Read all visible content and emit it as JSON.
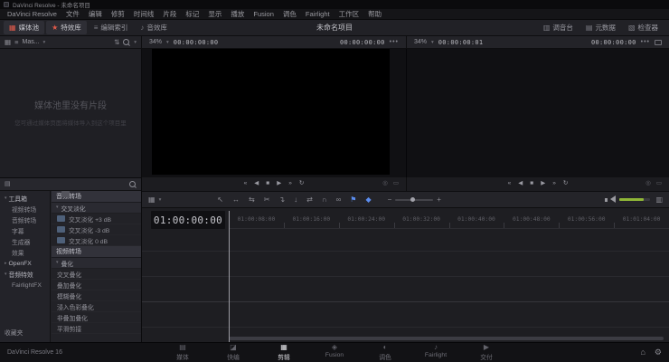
{
  "window": {
    "titlebar": "DaVinci Resolve - 未命名项目",
    "project_title": "未命名项目",
    "version_label": "DaVinci Resolve 16"
  },
  "colors": {
    "accent": "#e05a4a",
    "marker_blue": "#5b8def",
    "audio_level_green": "#8fb637"
  },
  "menubar": {
    "items": [
      "DaVinci Resolve",
      "文件",
      "编辑",
      "修剪",
      "时间线",
      "片段",
      "标记",
      "显示",
      "播放",
      "Fusion",
      "调色",
      "Fairlight",
      "工作区",
      "帮助"
    ]
  },
  "panel_toolbar": {
    "left": [
      {
        "name": "media-pool",
        "icon": "media-pool-icon",
        "glyph": "▦",
        "label": "媒体池",
        "active": true
      },
      {
        "name": "effects-library",
        "icon": "effects-library-icon",
        "glyph": "★",
        "label": "特效库",
        "active": true
      },
      {
        "name": "edit-index",
        "icon": "edit-index-icon",
        "glyph": "≡",
        "label": "编辑索引",
        "active": false
      },
      {
        "name": "sound-library",
        "icon": "sound-library-icon",
        "glyph": "♪",
        "label": "音效库",
        "active": false
      }
    ],
    "right": [
      {
        "name": "mixer",
        "icon": "mixer-icon",
        "glyph": "▥",
        "label": "调音台",
        "active": false
      },
      {
        "name": "metadata",
        "icon": "metadata-icon",
        "glyph": "▤",
        "label": "元数据",
        "active": false
      },
      {
        "name": "inspector",
        "icon": "inspector-icon",
        "glyph": "▧",
        "label": "检查器",
        "active": false
      }
    ]
  },
  "media_pool": {
    "bin_label": "Mas...",
    "empty_title": "媒体池里没有片段",
    "empty_subtitle": "您可通过媒体页面将媒体导入到这个项目里"
  },
  "effects_panel": {
    "nav": [
      {
        "name": "toolbox",
        "label": "工具箱",
        "level": 0,
        "header": true,
        "expandable": true,
        "expanded": true
      },
      {
        "name": "video-transitions",
        "label": "视频转场",
        "level": 1
      },
      {
        "name": "audio-transitions",
        "label": "音频转场",
        "level": 1
      },
      {
        "name": "titles",
        "label": "字幕",
        "level": 1
      },
      {
        "name": "generators",
        "label": "生成器",
        "level": 1
      },
      {
        "name": "effects",
        "label": "效果",
        "level": 1
      },
      {
        "name": "openfx",
        "label": "OpenFX",
        "level": 0,
        "header": true,
        "expandable": true,
        "expanded": false
      },
      {
        "name": "audio-fx",
        "label": "音频特效",
        "level": 0,
        "header": true,
        "expandable": true,
        "expanded": true
      },
      {
        "name": "fairlightfx",
        "label": "FairlightFX",
        "level": 1
      },
      {
        "name": "favorites",
        "label": "收藏夹",
        "level": 0,
        "bottom": true
      }
    ],
    "list": [
      {
        "type": "header",
        "label": "音频转场"
      },
      {
        "type": "group",
        "label": "交叉淡化"
      },
      {
        "type": "item",
        "label": "交叉淡化 +3 dB",
        "kind": "audio"
      },
      {
        "type": "item",
        "label": "交叉淡化 -3 dB",
        "kind": "audio"
      },
      {
        "type": "item",
        "label": "交叉淡化 0 dB",
        "kind": "audio"
      },
      {
        "type": "header",
        "label": "视频转场"
      },
      {
        "type": "group",
        "label": "叠化"
      },
      {
        "type": "item",
        "label": "交叉叠化",
        "kind": "video"
      },
      {
        "type": "item",
        "label": "叠加叠化",
        "kind": "video"
      },
      {
        "type": "item",
        "label": "模糊叠化",
        "kind": "video"
      },
      {
        "type": "item",
        "label": "浸入色彩叠化",
        "kind": "video"
      },
      {
        "type": "item",
        "label": "非叠加叠化",
        "kind": "video"
      },
      {
        "type": "item",
        "label": "平滑剪接",
        "kind": "video"
      }
    ]
  },
  "viewers": {
    "source": {
      "zoom": "34%",
      "current_timecode": "00:00:00:00",
      "duration_timecode": "00:00:00:00",
      "menu": "•••"
    },
    "timeline": {
      "zoom": "34%",
      "current_timecode": "00:00:00:01",
      "duration_timecode": "00:00:00:00",
      "menu": "•••"
    }
  },
  "transport": {
    "buttons": [
      {
        "name": "jump-first",
        "glyph": "«"
      },
      {
        "name": "play-reverse",
        "glyph": "◀"
      },
      {
        "name": "stop",
        "glyph": "■"
      },
      {
        "name": "play-forward",
        "glyph": "▶"
      },
      {
        "name": "jump-last",
        "glyph": "»"
      },
      {
        "name": "loop",
        "glyph": "↻"
      }
    ]
  },
  "timeline_toolbar": {
    "view_options": {
      "name": "timeline-view-options-icon",
      "glyph": "▦"
    },
    "tools": [
      {
        "name": "selection-mode-icon",
        "glyph": "↖"
      },
      {
        "name": "trim-edit-mode-icon",
        "glyph": "↔"
      },
      {
        "name": "dynamic-trim-mode-icon",
        "glyph": "⇆"
      },
      {
        "name": "blade-edit-mode-icon",
        "glyph": "✂"
      },
      {
        "name": "insert-clip-icon",
        "glyph": "↴"
      },
      {
        "name": "overwrite-clip-icon",
        "glyph": "↓"
      },
      {
        "name": "replace-clip-icon",
        "glyph": "⇄"
      },
      {
        "name": "snapping-icon",
        "glyph": "∩"
      },
      {
        "name": "linked-selection-icon",
        "glyph": "∞"
      },
      {
        "name": "flag-icon",
        "glyph": "⚑",
        "color": "#5b8def"
      },
      {
        "name": "marker-icon",
        "glyph": "◆",
        "color": "#5b8def"
      }
    ]
  },
  "timeline": {
    "playhead_timecode": "01:00:00:00",
    "ruler_labels": [
      "01:00:08:00",
      "01:00:16:00",
      "01:00:24:00",
      "01:00:32:00",
      "01:00:40:00",
      "01:00:48:00",
      "01:00:56:00",
      "01:01:04:00"
    ]
  },
  "pages": [
    {
      "name": "media",
      "label": "媒体",
      "glyph": "▤",
      "active": false
    },
    {
      "name": "cut",
      "label": "快编",
      "glyph": "◪",
      "active": false
    },
    {
      "name": "edit",
      "label": "剪辑",
      "glyph": "▦",
      "active": true
    },
    {
      "name": "fusion",
      "label": "Fusion",
      "glyph": "◈",
      "active": false
    },
    {
      "name": "color",
      "label": "调色",
      "glyph": "◐",
      "active": false
    },
    {
      "name": "fairlight",
      "label": "Fairlight",
      "glyph": "♪",
      "active": false
    },
    {
      "name": "deliver",
      "label": "交付",
      "glyph": "▶",
      "active": false
    }
  ]
}
